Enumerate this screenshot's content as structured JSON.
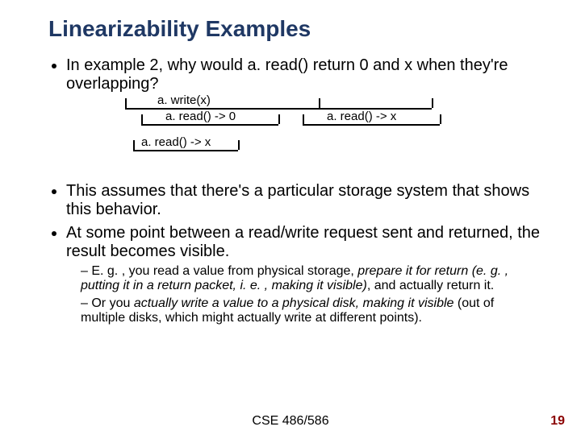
{
  "title": "Linearizability Examples",
  "bullets": {
    "b1": "In example 2, why would a. read() return 0 and x when they're overlapping?",
    "b2": "This assumes that there's a particular storage system that shows this behavior.",
    "b3": "At some point between a read/write request sent and returned, the result becomes visible.",
    "s1_a": "E. g. , you read a value from physical storage, ",
    "s1_b": "prepare it for return (e. g. , putting it in a return packet, i. e. , making it visible)",
    "s1_c": ", and actually return it.",
    "s2_a": "Or you ",
    "s2_b": "actually write a value to a physical disk, making it visible",
    "s2_c": " (out of multiple disks, which might actually write at different points)."
  },
  "diagram": {
    "op1": "a. write(x)",
    "op2": "a. read() -> 0",
    "op3": "a. read() -> x",
    "op4": "a. read() -> x"
  },
  "footer": {
    "center": "CSE 486/586",
    "page": "19"
  }
}
